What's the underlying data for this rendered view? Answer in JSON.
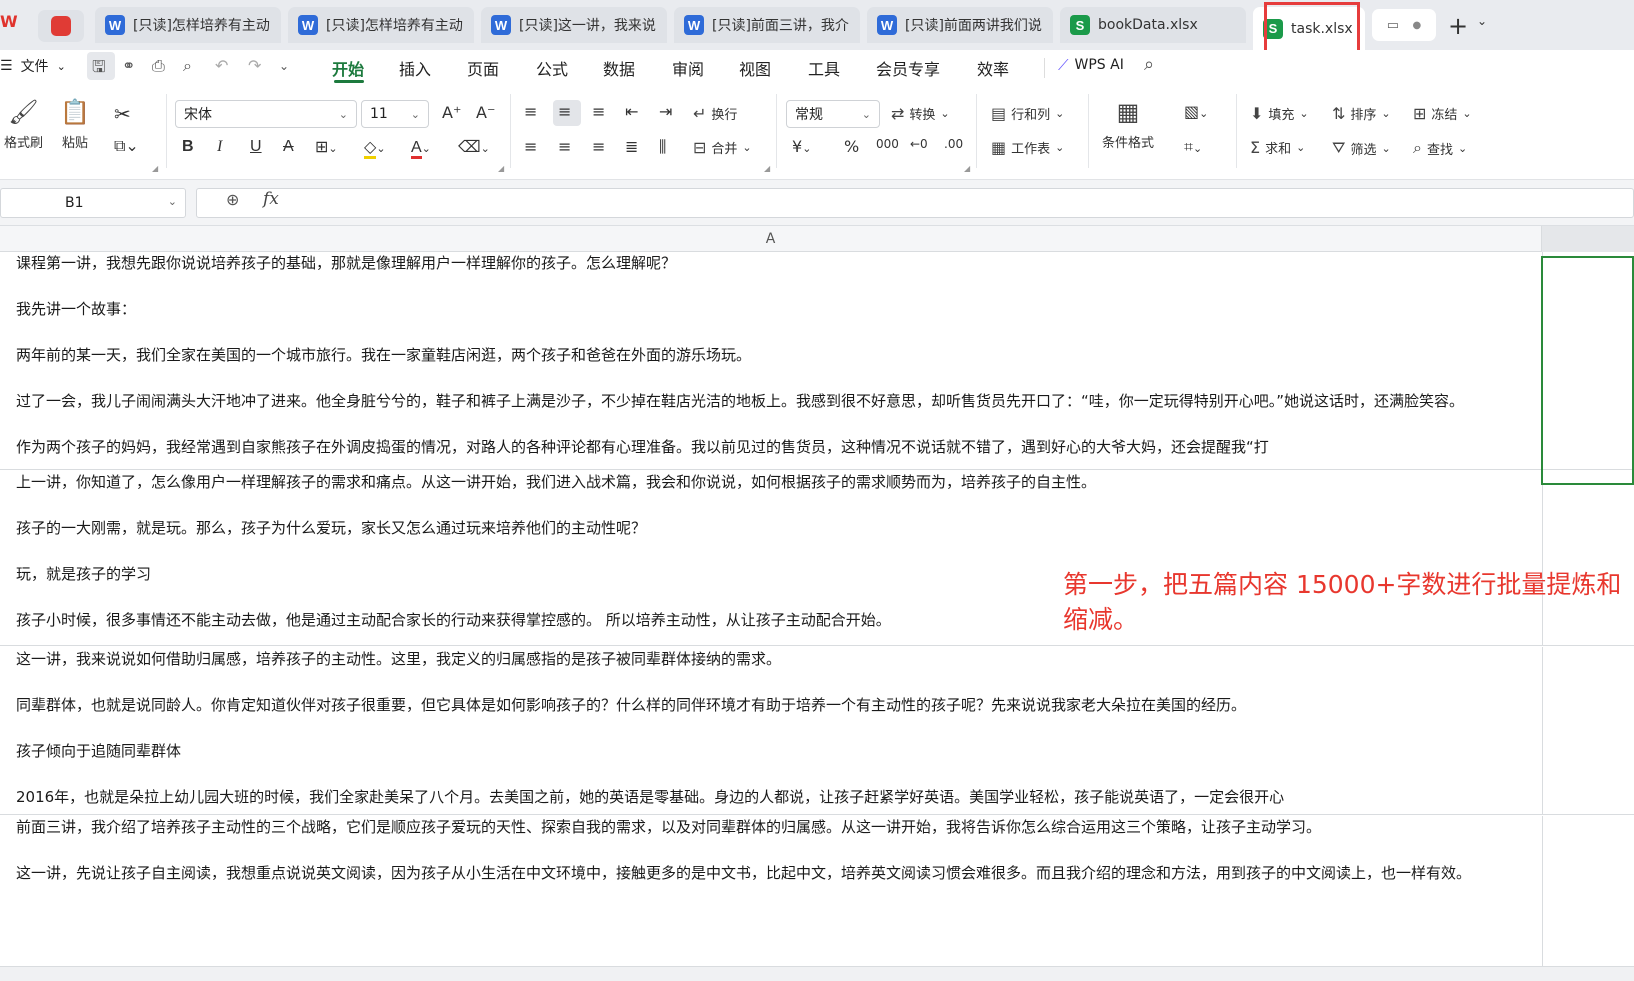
{
  "tabs": [
    {
      "label": "[只读]怎样培养有主动",
      "type": "doc"
    },
    {
      "label": "[只读]怎样培养有主动",
      "type": "doc"
    },
    {
      "label": "[只读]这一讲，我来说",
      "type": "doc"
    },
    {
      "label": "[只读]前面三讲，我介",
      "type": "doc"
    },
    {
      "label": "[只读]前面两讲我们说",
      "type": "doc"
    },
    {
      "label": "bookData.xlsx",
      "type": "sheet"
    },
    {
      "label": "task.xlsx",
      "type": "sheet",
      "active": true
    }
  ],
  "menu": {
    "file": "文件",
    "tabs": [
      "开始",
      "插入",
      "页面",
      "公式",
      "数据",
      "审阅",
      "视图",
      "工具",
      "会员专享",
      "效率"
    ],
    "active_tab": "开始",
    "ai": "WPS AI"
  },
  "ribbon": {
    "format_painter": "格式刷",
    "paste": "粘贴",
    "font_name": "宋体",
    "font_size": "11",
    "wrap": "换行",
    "merge": "合并",
    "number_format": "常规",
    "convert": "转换",
    "row_col": "行和列",
    "worksheet": "工作表",
    "cond_format": "条件格式",
    "fill": "填充",
    "sort": "排序",
    "freeze": "冻结",
    "sum": "求和",
    "filter": "筛选",
    "find": "查找"
  },
  "formula_bar": {
    "cell_ref": "B1",
    "fx": "fx",
    "value": ""
  },
  "grid": {
    "column_a": "A",
    "rows": [
      {
        "lines": [
          "课程第一讲，我想先跟你说说培养孩子的基础，那就是像理解用户一样理解你的孩子。怎么理解呢？",
          "我先讲一个故事：",
          "两年前的某一天，我们全家在美国的一个城市旅行。我在一家童鞋店闲逛，两个孩子和爸爸在外面的游乐场玩。",
          "过了一会，我儿子闹闹满头大汗地冲了进来。他全身脏兮兮的，鞋子和裤子上满是沙子，不少掉在鞋店光洁的地板上。我感到很不好意思，却听售货员先开口了：“哇，你一定玩得特别开心吧。”她说这话时，还满脸笑容。",
          "作为两个孩子的妈妈，我经常遇到自家熊孩子在外调皮捣蛋的情况，对路人的各种评论都有心理准备。我以前见过的售货员，这种情况不说话就不错了，遇到好心的大爷大妈，还会提醒我“打"
        ]
      },
      {
        "lines": [
          "上一讲，你知道了，怎么像用户一样理解孩子的需求和痛点。从这一讲开始，我们进入战术篇，我会和你说说，如何根据孩子的需求顺势而为，培养孩子的自主性。",
          "孩子的一大刚需，就是玩。那么，孩子为什么爱玩，家长又怎么通过玩来培养他们的主动性呢？",
          "玩，就是孩子的学习",
          "孩子小时候，很多事情还不能主动去做，他是通过主动配合家长的行动来获得掌控感的。 所以培养主动性，从让孩子主动配合开始。"
        ]
      },
      {
        "lines": [
          "这一讲，我来说说如何借助归属感，培养孩子的主动性。这里，我定义的归属感指的是孩子被同辈群体接纳的需求。",
          "同辈群体，也就是说同龄人。你肯定知道伙伴对孩子很重要，但它具体是如何影响孩子的？什么样的同伴环境才有助于培养一个有主动性的孩子呢？先来说说我家老大朵拉在美国的经历。",
          "孩子倾向于追随同辈群体",
          "2016年，也就是朵拉上幼儿园大班的时候，我们全家赴美呆了八个月。去美国之前，她的英语是零基础。身边的人都说，让孩子赶紧学好英语。美国学业轻松，孩子能说英语了，一定会很开心"
        ]
      },
      {
        "lines": [
          "前面三讲，我介绍了培养孩子主动性的三个战略，它们是顺应孩子爱玩的天性、探索自我的需求，以及对同辈群体的归属感。从这一讲开始，我将告诉你怎么综合运用这三个策略，让孩子主动学习。",
          "这一讲，先说让孩子自主阅读，我想重点说说英文阅读，因为孩子从小生活在中文环境中，接触更多的是中文书，比起中文，培养英文阅读习惯会难很多。而且我介绍的理念和方法，用到孩子的中文阅读上，也一样有效。"
        ]
      }
    ]
  },
  "annotation": "第一步，把五篇内容 15000+字数进行批量提炼和缩减。",
  "colors": {
    "accent_green": "#1d7a3e",
    "annotation_red": "#e8372e",
    "word_blue": "#2f6bd8",
    "sheet_green": "#1b9a4a"
  }
}
